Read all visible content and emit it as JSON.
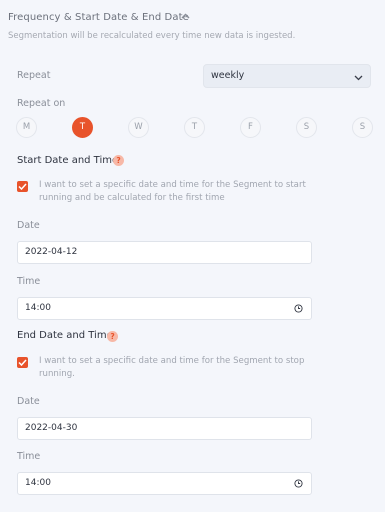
{
  "header": {
    "title": "Frequency & Start Date & End Date",
    "subtitle": "Segmentation will be recalculated every time new data is ingested."
  },
  "repeat": {
    "label": "Repeat",
    "selected": "weekly"
  },
  "repeat_on": {
    "label": "Repeat on",
    "days": [
      "M",
      "T",
      "W",
      "T",
      "F",
      "S",
      "S"
    ],
    "active_index": 1
  },
  "start": {
    "title": "Start Date and Time",
    "help": "?",
    "checkbox_text": "I want to set a specific date and time for the Segment to start running and be calculated for the first time",
    "checked": true,
    "date_label": "Date",
    "date_value": "2022-04-12",
    "time_label": "Time",
    "time_value": "14:00"
  },
  "end": {
    "title": "End Date and Time",
    "help": "?",
    "checkbox_text": "I want to set a specific date and time for the Segment to stop running.",
    "checked": true,
    "date_label": "Date",
    "date_value": "2022-04-30",
    "time_label": "Time",
    "time_value": "14:00"
  },
  "colors": {
    "accent": "#e8532b",
    "background": "#f4f6fb"
  }
}
